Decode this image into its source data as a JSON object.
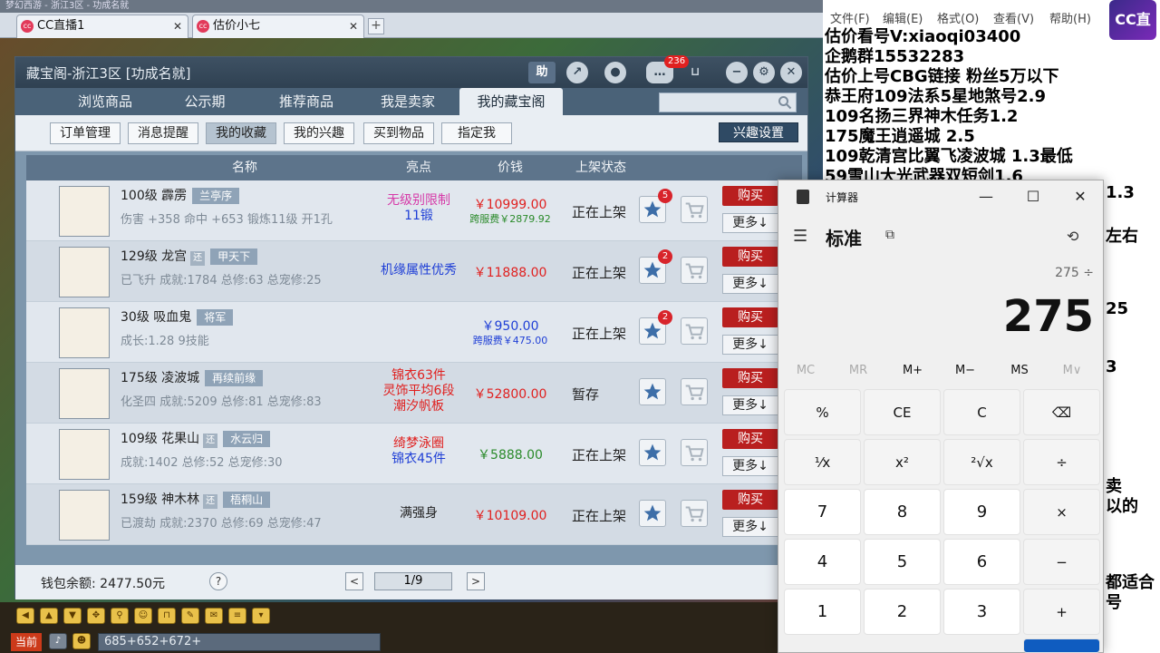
{
  "browser": {
    "title_strip": "梦幻西游 - 浙江3区 - 功成名就",
    "tabs": [
      {
        "label": "CC直播1",
        "active": true
      },
      {
        "label": "估价小七",
        "active": false
      }
    ],
    "new_tab": "+"
  },
  "treasure_window": {
    "title": "藏宝阁-浙江3区 [功成名就]",
    "help_btn": "助",
    "message_badge": "236",
    "main_tabs": [
      "浏览商品",
      "公示期",
      "推荐商品",
      "我是卖家",
      "我的藏宝阁"
    ],
    "active_main_tab": 4,
    "sub_tabs": [
      "订单管理",
      "消息提醒",
      "我的收藏",
      "我的兴趣",
      "买到物品",
      "指定我"
    ],
    "active_sub_tab": 2,
    "interest_settings": "兴趣设置",
    "table": {
      "headers": {
        "name": "名称",
        "highlight": "亮点",
        "price": "价钱",
        "status": "上架状态"
      },
      "rows": [
        {
          "title": "100级 霹雳",
          "tag": "兰亭序",
          "small_tag": "",
          "desc": "伤害 +358 命中 +653 锻炼11级 开1孔",
          "highlights": [
            "无级别限制",
            "11锻"
          ],
          "highlight_colors": [
            "#d63aa8",
            "#1f3fd6"
          ],
          "price": "￥10999.00",
          "price_color": "#e0201f",
          "fee": "跨服费￥2879.92",
          "fee_color": "#2a8a2a",
          "status": "正在上架",
          "fav_count": "5",
          "buy": "购买",
          "more": "更多↓"
        },
        {
          "title": "129级 龙宫",
          "tag": "甲天下",
          "small_tag": "还",
          "desc": "已飞升 成就:1784 总修:63 总宠修:25",
          "highlights": [
            "机缘属性优秀"
          ],
          "highlight_colors": [
            "#1f3fd6"
          ],
          "price": "￥11888.00",
          "price_color": "#e0201f",
          "fee": "",
          "fee_color": "#2a8a2a",
          "status": "正在上架",
          "fav_count": "2",
          "buy": "购买",
          "more": "更多↓"
        },
        {
          "title": "30级 吸血鬼",
          "tag": "将军",
          "small_tag": "",
          "desc": "成长:1.28 9技能",
          "highlights": [],
          "highlight_colors": [],
          "price": "￥950.00",
          "price_color": "#1f3fd6",
          "fee": "跨服费￥475.00",
          "fee_color": "#1f3fd6",
          "status": "正在上架",
          "fav_count": "2",
          "buy": "购买",
          "more": "更多↓"
        },
        {
          "title": "175级 凌波城",
          "tag": "再续前缘",
          "small_tag": "",
          "desc": "化圣四 成就:5209 总修:81 总宠修:83",
          "highlights": [
            "锦衣63件",
            "灵饰平均6段",
            "潮汐帆板"
          ],
          "highlight_colors": [
            "#e0201f",
            "#e0201f",
            "#e0201f"
          ],
          "price": "￥52800.00",
          "price_color": "#e0201f",
          "fee": "",
          "fee_color": "#2a8a2a",
          "status": "暂存",
          "fav_count": "",
          "buy": "购买",
          "more": "更多↓"
        },
        {
          "title": "109级 花果山",
          "tag": "水云归",
          "small_tag": "还",
          "desc": "成就:1402 总修:52 总宠修:30",
          "highlights": [
            "绮梦泳圈",
            "锦衣45件"
          ],
          "highlight_colors": [
            "#e0201f",
            "#1f3fd6"
          ],
          "price": "￥5888.00",
          "price_color": "#2a8a2a",
          "fee": "",
          "fee_color": "#2a8a2a",
          "status": "正在上架",
          "fav_count": "",
          "buy": "购买",
          "more": "更多↓"
        },
        {
          "title": "159级 神木林",
          "tag": "梧桐山",
          "small_tag": "还",
          "desc": "已渡劫 成就:2370 总修:69 总宠修:47",
          "highlights": [
            "满强身"
          ],
          "highlight_colors": [
            "#222222"
          ],
          "price": "￥10109.00",
          "price_color": "#e0201f",
          "fee": "",
          "fee_color": "#2a8a2a",
          "status": "正在上架",
          "fav_count": "",
          "buy": "购买",
          "more": "更多↓"
        }
      ]
    },
    "footer": {
      "wallet": "钱包余额: 2477.50元",
      "help": "?",
      "page": "1/9",
      "prev": "<",
      "next": ">"
    }
  },
  "game_bar": {
    "current_label": "当前",
    "chat_input": "685+652+672+"
  },
  "notepad": {
    "menu": [
      "文件(F)",
      "编辑(E)",
      "格式(O)",
      "查看(V)",
      "帮助(H)"
    ],
    "lines": [
      "估价看号V:xiaoqi03400",
      "企鹅群15532283",
      "估价上号CBG链接  粉丝5万以下",
      "恭王府109法系5星地煞号2.9",
      "109名扬三界神木任务1.2",
      "175魔王逍遥城 2.5",
      "109乾清宫比翼飞凌波城 1.3最低",
      "59雪山大光武器双短剑1.6"
    ],
    "right_fragments": [
      "1.3",
      "左右",
      "25",
      "3",
      "卖",
      "以的",
      "都适合",
      "号"
    ],
    "logo": "CC直播"
  },
  "calculator": {
    "title": "计算器",
    "mode": "标准",
    "expression": "275 ÷",
    "display": "275",
    "memory": [
      "MC",
      "MR",
      "M+",
      "M−",
      "MS",
      "M∨"
    ],
    "keys": [
      [
        "%",
        "CE",
        "C",
        "⌫"
      ],
      [
        "¹⁄x",
        "x²",
        "²√x",
        "÷"
      ],
      [
        "7",
        "8",
        "9",
        "×"
      ],
      [
        "4",
        "5",
        "6",
        "−"
      ],
      [
        "1",
        "2",
        "3",
        "+"
      ]
    ]
  }
}
